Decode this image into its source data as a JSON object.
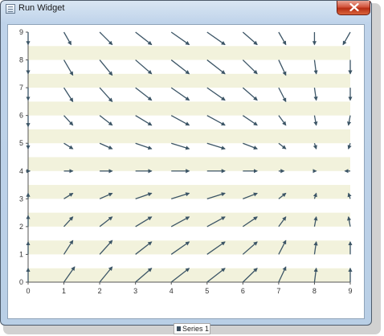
{
  "window": {
    "title": "Run Widget",
    "icons": {
      "app": "window-app-icon",
      "close": "close-x-icon"
    }
  },
  "colors": {
    "band": "#f2f2dc",
    "arrow": "#3c5566",
    "axis": "#555555",
    "close_button": "#c9422a"
  },
  "chart_data": {
    "type": "vector-field",
    "title": "",
    "xlabel": "",
    "ylabel": "",
    "xlim": [
      0,
      9
    ],
    "ylim": [
      0,
      9
    ],
    "x_ticks": [
      "0",
      "1",
      "2",
      "3",
      "4",
      "5",
      "6",
      "7",
      "8",
      "9"
    ],
    "y_ticks": [
      "0",
      "1",
      "2",
      "3",
      "4",
      "5",
      "6",
      "7",
      "8",
      "9"
    ],
    "grid": "alternating horizontal bands",
    "legend_position": "bottom",
    "series": [
      {
        "name": "Series 1",
        "description": "arrow at each integer (x,y); dx,dy in data units",
        "vectors": [
          {
            "x": 0,
            "y": 0,
            "dx": 0.0,
            "dy": 0.5
          },
          {
            "x": 1,
            "y": 0,
            "dx": 0.3,
            "dy": 0.55
          },
          {
            "x": 2,
            "y": 0,
            "dx": 0.35,
            "dy": 0.55
          },
          {
            "x": 3,
            "y": 0,
            "dx": 0.45,
            "dy": 0.5
          },
          {
            "x": 4,
            "y": 0,
            "dx": 0.5,
            "dy": 0.5
          },
          {
            "x": 5,
            "y": 0,
            "dx": 0.5,
            "dy": 0.5
          },
          {
            "x": 6,
            "y": 0,
            "dx": 0.4,
            "dy": 0.5
          },
          {
            "x": 7,
            "y": 0,
            "dx": 0.2,
            "dy": 0.55
          },
          {
            "x": 8,
            "y": 0,
            "dx": 0.05,
            "dy": 0.5
          },
          {
            "x": 9,
            "y": 0,
            "dx": 0.0,
            "dy": 0.5
          },
          {
            "x": 0,
            "y": 1,
            "dx": 0.0,
            "dy": 0.45
          },
          {
            "x": 1,
            "y": 1,
            "dx": 0.25,
            "dy": 0.5
          },
          {
            "x": 2,
            "y": 1,
            "dx": 0.35,
            "dy": 0.5
          },
          {
            "x": 3,
            "y": 1,
            "dx": 0.45,
            "dy": 0.45
          },
          {
            "x": 4,
            "y": 1,
            "dx": 0.5,
            "dy": 0.45
          },
          {
            "x": 5,
            "y": 1,
            "dx": 0.5,
            "dy": 0.45
          },
          {
            "x": 6,
            "y": 1,
            "dx": 0.4,
            "dy": 0.45
          },
          {
            "x": 7,
            "y": 1,
            "dx": 0.2,
            "dy": 0.5
          },
          {
            "x": 8,
            "y": 1,
            "dx": 0.05,
            "dy": 0.45
          },
          {
            "x": 9,
            "y": 1,
            "dx": 0.0,
            "dy": 0.45
          },
          {
            "x": 0,
            "y": 2,
            "dx": 0.0,
            "dy": 0.4
          },
          {
            "x": 1,
            "y": 2,
            "dx": 0.25,
            "dy": 0.35
          },
          {
            "x": 2,
            "y": 2,
            "dx": 0.35,
            "dy": 0.35
          },
          {
            "x": 3,
            "y": 2,
            "dx": 0.45,
            "dy": 0.35
          },
          {
            "x": 4,
            "y": 2,
            "dx": 0.5,
            "dy": 0.35
          },
          {
            "x": 5,
            "y": 2,
            "dx": 0.5,
            "dy": 0.35
          },
          {
            "x": 6,
            "y": 2,
            "dx": 0.4,
            "dy": 0.35
          },
          {
            "x": 7,
            "y": 2,
            "dx": 0.2,
            "dy": 0.35
          },
          {
            "x": 8,
            "y": 2,
            "dx": 0.05,
            "dy": 0.35
          },
          {
            "x": 9,
            "y": 2,
            "dx": -0.05,
            "dy": 0.35
          },
          {
            "x": 0,
            "y": 3,
            "dx": 0.0,
            "dy": 0.2
          },
          {
            "x": 1,
            "y": 3,
            "dx": 0.25,
            "dy": 0.2
          },
          {
            "x": 2,
            "y": 3,
            "dx": 0.35,
            "dy": 0.2
          },
          {
            "x": 3,
            "y": 3,
            "dx": 0.45,
            "dy": 0.2
          },
          {
            "x": 4,
            "y": 3,
            "dx": 0.5,
            "dy": 0.2
          },
          {
            "x": 5,
            "y": 3,
            "dx": 0.5,
            "dy": 0.2
          },
          {
            "x": 6,
            "y": 3,
            "dx": 0.4,
            "dy": 0.2
          },
          {
            "x": 7,
            "y": 3,
            "dx": 0.2,
            "dy": 0.2
          },
          {
            "x": 8,
            "y": 3,
            "dx": 0.05,
            "dy": 0.2
          },
          {
            "x": 9,
            "y": 3,
            "dx": -0.05,
            "dy": 0.2
          },
          {
            "x": 0,
            "y": 4,
            "dx": 0.05,
            "dy": 0.0
          },
          {
            "x": 1,
            "y": 4,
            "dx": 0.25,
            "dy": 0.0
          },
          {
            "x": 2,
            "y": 4,
            "dx": 0.35,
            "dy": 0.0
          },
          {
            "x": 3,
            "y": 4,
            "dx": 0.45,
            "dy": 0.0
          },
          {
            "x": 4,
            "y": 4,
            "dx": 0.5,
            "dy": 0.0
          },
          {
            "x": 5,
            "y": 4,
            "dx": 0.5,
            "dy": 0.0
          },
          {
            "x": 6,
            "y": 4,
            "dx": 0.4,
            "dy": 0.0
          },
          {
            "x": 7,
            "y": 4,
            "dx": 0.15,
            "dy": 0.0
          },
          {
            "x": 8,
            "y": 4,
            "dx": 0.05,
            "dy": 0.0
          },
          {
            "x": 9,
            "y": 4,
            "dx": -0.15,
            "dy": 0.0
          },
          {
            "x": 0,
            "y": 5,
            "dx": 0.0,
            "dy": -0.2
          },
          {
            "x": 1,
            "y": 5,
            "dx": 0.25,
            "dy": -0.2
          },
          {
            "x": 2,
            "y": 5,
            "dx": 0.35,
            "dy": -0.2
          },
          {
            "x": 3,
            "y": 5,
            "dx": 0.45,
            "dy": -0.2
          },
          {
            "x": 4,
            "y": 5,
            "dx": 0.5,
            "dy": -0.2
          },
          {
            "x": 5,
            "y": 5,
            "dx": 0.5,
            "dy": -0.2
          },
          {
            "x": 6,
            "y": 5,
            "dx": 0.4,
            "dy": -0.2
          },
          {
            "x": 7,
            "y": 5,
            "dx": 0.2,
            "dy": -0.2
          },
          {
            "x": 8,
            "y": 5,
            "dx": 0.05,
            "dy": -0.2
          },
          {
            "x": 9,
            "y": 5,
            "dx": -0.05,
            "dy": -0.2
          },
          {
            "x": 0,
            "y": 6,
            "dx": 0.0,
            "dy": -0.4
          },
          {
            "x": 1,
            "y": 6,
            "dx": 0.25,
            "dy": -0.35
          },
          {
            "x": 2,
            "y": 6,
            "dx": 0.35,
            "dy": -0.35
          },
          {
            "x": 3,
            "y": 6,
            "dx": 0.45,
            "dy": -0.35
          },
          {
            "x": 4,
            "y": 6,
            "dx": 0.5,
            "dy": -0.35
          },
          {
            "x": 5,
            "y": 6,
            "dx": 0.5,
            "dy": -0.35
          },
          {
            "x": 6,
            "y": 6,
            "dx": 0.4,
            "dy": -0.35
          },
          {
            "x": 7,
            "y": 6,
            "dx": 0.2,
            "dy": -0.35
          },
          {
            "x": 8,
            "y": 6,
            "dx": 0.05,
            "dy": -0.35
          },
          {
            "x": 9,
            "y": 6,
            "dx": -0.05,
            "dy": -0.35
          },
          {
            "x": 0,
            "y": 7,
            "dx": 0.0,
            "dy": -0.45
          },
          {
            "x": 1,
            "y": 7,
            "dx": 0.25,
            "dy": -0.5
          },
          {
            "x": 2,
            "y": 7,
            "dx": 0.35,
            "dy": -0.5
          },
          {
            "x": 3,
            "y": 7,
            "dx": 0.45,
            "dy": -0.45
          },
          {
            "x": 4,
            "y": 7,
            "dx": 0.5,
            "dy": -0.45
          },
          {
            "x": 5,
            "y": 7,
            "dx": 0.5,
            "dy": -0.45
          },
          {
            "x": 6,
            "y": 7,
            "dx": 0.4,
            "dy": -0.45
          },
          {
            "x": 7,
            "y": 7,
            "dx": 0.2,
            "dy": -0.5
          },
          {
            "x": 8,
            "y": 7,
            "dx": 0.05,
            "dy": -0.45
          },
          {
            "x": 9,
            "y": 7,
            "dx": 0.0,
            "dy": -0.45
          },
          {
            "x": 0,
            "y": 8,
            "dx": 0.0,
            "dy": -0.5
          },
          {
            "x": 1,
            "y": 8,
            "dx": 0.25,
            "dy": -0.55
          },
          {
            "x": 2,
            "y": 8,
            "dx": 0.35,
            "dy": -0.55
          },
          {
            "x": 3,
            "y": 8,
            "dx": 0.45,
            "dy": -0.5
          },
          {
            "x": 4,
            "y": 8,
            "dx": 0.5,
            "dy": -0.5
          },
          {
            "x": 5,
            "y": 8,
            "dx": 0.5,
            "dy": -0.5
          },
          {
            "x": 6,
            "y": 8,
            "dx": 0.4,
            "dy": -0.5
          },
          {
            "x": 7,
            "y": 8,
            "dx": 0.2,
            "dy": -0.55
          },
          {
            "x": 8,
            "y": 8,
            "dx": 0.05,
            "dy": -0.5
          },
          {
            "x": 9,
            "y": 8,
            "dx": 0.0,
            "dy": -0.5
          },
          {
            "x": 0,
            "y": 9,
            "dx": 0.0,
            "dy": -0.45
          },
          {
            "x": 1,
            "y": 9,
            "dx": 0.2,
            "dy": -0.45
          },
          {
            "x": 2,
            "y": 9,
            "dx": 0.35,
            "dy": -0.45
          },
          {
            "x": 3,
            "y": 9,
            "dx": 0.45,
            "dy": -0.45
          },
          {
            "x": 4,
            "y": 9,
            "dx": 0.5,
            "dy": -0.45
          },
          {
            "x": 5,
            "y": 9,
            "dx": 0.5,
            "dy": -0.45
          },
          {
            "x": 6,
            "y": 9,
            "dx": 0.4,
            "dy": -0.45
          },
          {
            "x": 7,
            "y": 9,
            "dx": 0.2,
            "dy": -0.45
          },
          {
            "x": 8,
            "y": 9,
            "dx": 0.0,
            "dy": -0.45
          },
          {
            "x": 9,
            "y": 9,
            "dx": -0.2,
            "dy": -0.45
          }
        ]
      }
    ],
    "legend": [
      "Series 1"
    ]
  }
}
